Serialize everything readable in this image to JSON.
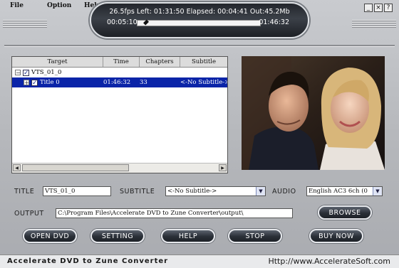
{
  "menu": {
    "items": [
      "File",
      "Option",
      "Help"
    ]
  },
  "window": {
    "min": "_",
    "close": "×",
    "help": "?"
  },
  "status": {
    "stats": "26.5fps Left: 01:31:50 Elapsed: 00:04:41 Out:45.2Mb",
    "current_time": "00:05:10",
    "total_time": "01:46:32"
  },
  "table": {
    "headers": [
      "Target",
      "Time",
      "Chapters",
      "Subtitle"
    ],
    "rows": [
      {
        "name": "VTS_01_0",
        "time": "",
        "chapters": "",
        "subtitle": "",
        "expander": "−",
        "checked": true,
        "selected": false,
        "indent": 0
      },
      {
        "name": "Title 0",
        "time": "01:46:32",
        "chapters": "33",
        "subtitle": "<-No Subtitle->",
        "expander": "+",
        "checked": true,
        "selected": true,
        "indent": 1
      }
    ]
  },
  "form": {
    "title_label": "TITLE",
    "title_value": "VTS_01_0",
    "subtitle_label": "SUBTITLE",
    "subtitle_value": "<-No Subtitle->",
    "audio_label": "AUDIO",
    "audio_value": "English AC3 6ch (0",
    "output_label": "OUTPUT",
    "output_value": "C:\\Program Files\\Accelerate DVD to Zune Converter\\output\\",
    "browse_label": "BROWSE"
  },
  "buttons": {
    "open_dvd": "OPEN DVD",
    "setting": "SETTING",
    "help": "HELP",
    "stop": "STOP",
    "buy_now": "BUY NOW"
  },
  "footer": {
    "title": "Accelerate DVD to Zune Converter",
    "url": "Http://www.AccelerateSoft.com"
  },
  "colors": {
    "selection": "#0a24a8",
    "button_dark": "#2a2f37"
  },
  "progress": {
    "seek_fraction": 0.05
  }
}
